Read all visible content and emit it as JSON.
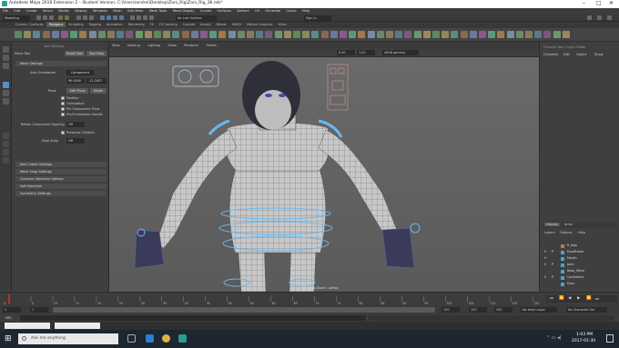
{
  "window": {
    "title": "Autodesk Maya 2016 Extension 2 – Student Version: C:\\Users\\andrei\\Desktop\\Zani_Rig\\Zani_Rig_36.mb*"
  },
  "menubar": [
    "File",
    "Edit",
    "Create",
    "Select",
    "Modify",
    "Display",
    "Windows",
    "Mesh",
    "Edit Mesh",
    "Mesh Tools",
    "Mesh Display",
    "Curves",
    "Surfaces",
    "Deform",
    "UV",
    "Generate",
    "Cache",
    "Help"
  ],
  "status": {
    "menuset": "Modeling",
    "live_surface": "No Live Surface",
    "sign_in": "Sign In"
  },
  "shelf_tabs": [
    {
      "label": "Curves / Surfaces",
      "active": false
    },
    {
      "label": "Polygons",
      "active": true
    },
    {
      "label": "Sculpting",
      "active": false
    },
    {
      "label": "Rigging",
      "active": false
    },
    {
      "label": "Animation",
      "active": false
    },
    {
      "label": "Rendering",
      "active": false
    },
    {
      "label": "FX",
      "active": false
    },
    {
      "label": "FX Caching",
      "active": false
    },
    {
      "label": "Custom",
      "active": false
    },
    {
      "label": "Arnold",
      "active": false
    },
    {
      "label": "Bifrost",
      "active": false
    },
    {
      "label": "MASH",
      "active": false
    },
    {
      "label": "Motion Graphics",
      "active": false
    },
    {
      "label": "XGen",
      "active": false
    }
  ],
  "tool_settings": {
    "title": "Tool Settings",
    "tool": "Move Tool",
    "reset": "Reset Tool",
    "help": "Tool Help",
    "section_move": "Move Settings",
    "axis_orientation_label": "Axis Orientation",
    "axis_orientation": "Component",
    "field_a": "90.0000",
    "field_b": "-12.3407",
    "pivot_label": "Pivot",
    "edit_pivot": "Edit Pivot",
    "reset_pivot": "Reset",
    "checks": [
      "Position",
      "Orientation",
      "Pin Component Pivot",
      "Pin/Orientation Handle"
    ],
    "preserve_children": "Preserve Children",
    "retain_label": "Retain Component Spacing",
    "retain_value": "Off",
    "snap_label": "Step Snap",
    "snap_value": "Off",
    "sections": [
      "Joint Orient Settings",
      "Move Snap Settings",
      "Common Selection Options",
      "Soft Selection",
      "Symmetry Settings"
    ]
  },
  "viewport": {
    "menu": [
      "View",
      "Shading",
      "Lighting",
      "Show",
      "Renderer",
      "Panels"
    ],
    "color_space": "sRGB gamma",
    "values": [
      "0.00",
      "1.00"
    ],
    "camera_label": "persp",
    "symmetry": "XY Pan/Zoom : persp"
  },
  "right_panel": {
    "top_title": "Channel Box / Layer Editor",
    "top_tabs": [
      "Channels",
      "Edit",
      "Object",
      "Show"
    ],
    "layer_tabs": [
      "Display",
      "Anim"
    ],
    "layer_menu": [
      "Layers",
      "Options",
      "Help"
    ],
    "layers": [
      {
        "v": "",
        "p": "",
        "name": "R_legs"
      },
      {
        "v": "V",
        "p": "P",
        "name": "FaceFrame"
      },
      {
        "v": "V",
        "p": "",
        "name": "Mouth"
      },
      {
        "v": "V",
        "p": "P",
        "name": "Joint"
      },
      {
        "v": "",
        "p": "",
        "name": "Base_Mesh"
      },
      {
        "v": "V",
        "p": "P",
        "name": "Controllers"
      },
      {
        "v": "",
        "p": "",
        "name": "Eyes"
      }
    ]
  },
  "timeline": {
    "ticks": [
      "5",
      "10",
      "15",
      "20",
      "25",
      "30",
      "35",
      "40",
      "45",
      "50",
      "55",
      "60",
      "65",
      "70",
      "75",
      "80",
      "85",
      "90",
      "95",
      "100",
      "105",
      "110",
      "115",
      "120"
    ],
    "current_frame": "1",
    "range_start": "1",
    "range_start2": "1",
    "range_end": "120",
    "range_end2": "120",
    "range_max": "200",
    "anim_layer": "No Anim Layer",
    "char_set": "No Character Set"
  },
  "mel": {
    "label": "MEL"
  },
  "taskbar": {
    "search": "Ask me anything",
    "time": "1:03 PM",
    "date": "2017-01-30"
  },
  "colors": {
    "accent": "#5a8fc8",
    "shelf_active": "#5a5a5a"
  }
}
